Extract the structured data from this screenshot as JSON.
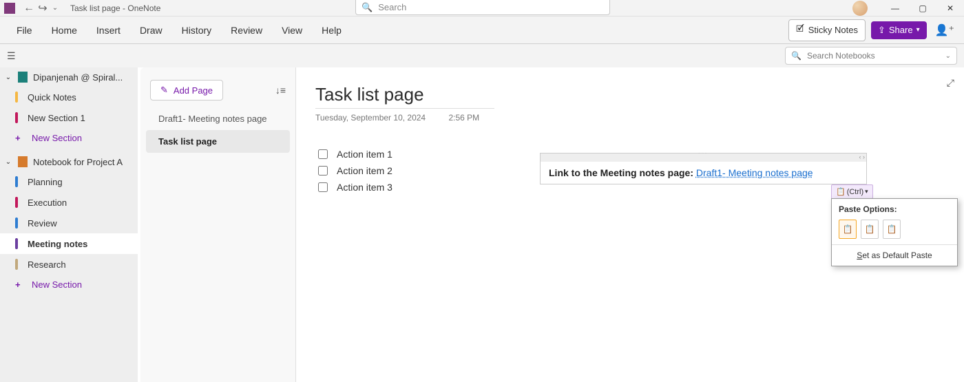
{
  "title_bar": {
    "app_icon": "onenote-icon",
    "document": "Task list page",
    "app": "OneNote",
    "combined": "Task list page  -  OneNote",
    "search_placeholder": "Search"
  },
  "window_controls": {
    "min": "—",
    "max": "▢",
    "close": "✕"
  },
  "ribbon": {
    "tabs": [
      "File",
      "Home",
      "Insert",
      "Draw",
      "History",
      "Review",
      "View",
      "Help"
    ],
    "sticky": "Sticky Notes",
    "share": "Share"
  },
  "subbar": {
    "search_placeholder": "Search Notebooks"
  },
  "notebooks": [
    {
      "name": "Dipanjenah @ Spiral...",
      "icon_color": "teal",
      "sections": [
        {
          "name": "Quick Notes",
          "color": "#f5b742"
        },
        {
          "name": "New Section 1",
          "color": "#c2185b"
        }
      ],
      "new_section": "New Section"
    },
    {
      "name": "Notebook for Project A",
      "icon_color": "orange",
      "sections": [
        {
          "name": "Planning",
          "color": "#2e7dd1"
        },
        {
          "name": "Execution",
          "color": "#c2185b"
        },
        {
          "name": "Review",
          "color": "#2e7dd1"
        },
        {
          "name": "Meeting notes",
          "color": "#6b3fa0",
          "active": true
        },
        {
          "name": "Research",
          "color": "#c1a87c"
        }
      ],
      "new_section": "New Section"
    }
  ],
  "pages": {
    "add": "Add Page",
    "items": [
      {
        "name": "Draft1- Meeting notes page"
      },
      {
        "name": "Task list page",
        "active": true
      }
    ]
  },
  "content": {
    "title": "Task list page",
    "date": "Tuesday, September 10, 2024",
    "time": "2:56 PM",
    "tasks": [
      "Action item 1",
      "Action item 2",
      "Action item 3"
    ],
    "link_label": "Link to the Meeting notes page: ",
    "link_text": "Draft1- Meeting notes page"
  },
  "paste": {
    "ctrl": "(Ctrl)",
    "header": "Paste Options:",
    "set_default_pre": "S",
    "set_default_rest": "et as Default Paste"
  }
}
